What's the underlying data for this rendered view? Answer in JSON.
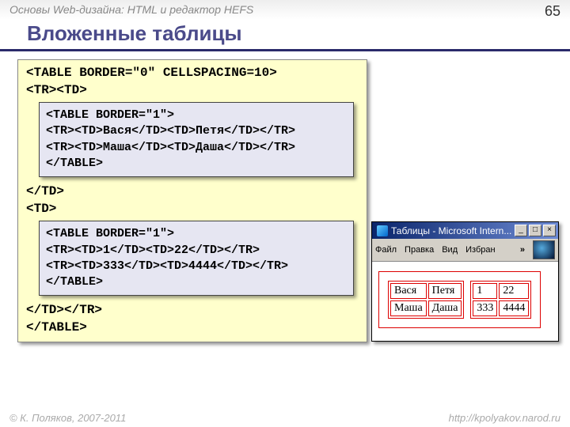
{
  "header": {
    "course": "Основы Web-дизайна: HTML и редактор HEFS",
    "page": "65"
  },
  "title": "Вложенные таблицы",
  "code": {
    "line1": "<TABLE BORDER=\"0\" CELLSPACING=10>",
    "line2": "<TR><TD>",
    "inner1": {
      "l1": "<TABLE BORDER=\"1\">",
      "l2": "   <TR><TD>Вася</TD><TD>Петя</TD></TR>",
      "l3": "   <TR><TD>Маша</TD><TD>Даша</TD></TR>",
      "l4": "</TABLE>"
    },
    "line3": "</TD>",
    "line4": "<TD>",
    "inner2": {
      "l1": "<TABLE BORDER=\"1\">",
      "l2": "   <TR><TD>1</TD><TD>22</TD></TR>",
      "l3": "   <TR><TD>333</TD><TD>4444</TD></TR>",
      "l4": "</TABLE>"
    },
    "line5": "</TD></TR>",
    "line6": "</TABLE>"
  },
  "browser": {
    "title": "Таблицы - Microsoft Intern...",
    "menu": {
      "file": "Файл",
      "edit": "Правка",
      "view": "Вид",
      "fav": "Избран",
      "chev": "»"
    },
    "btns": {
      "min": "_",
      "max": "□",
      "close": "×"
    },
    "t1": [
      [
        "Вася",
        "Петя"
      ],
      [
        "Маша",
        "Даша"
      ]
    ],
    "t2": [
      [
        "1",
        "22"
      ],
      [
        "333",
        "4444"
      ]
    ]
  },
  "footer": {
    "copyright": "© К. Поляков, 2007-2011",
    "url": "http://kpolyakov.narod.ru"
  }
}
